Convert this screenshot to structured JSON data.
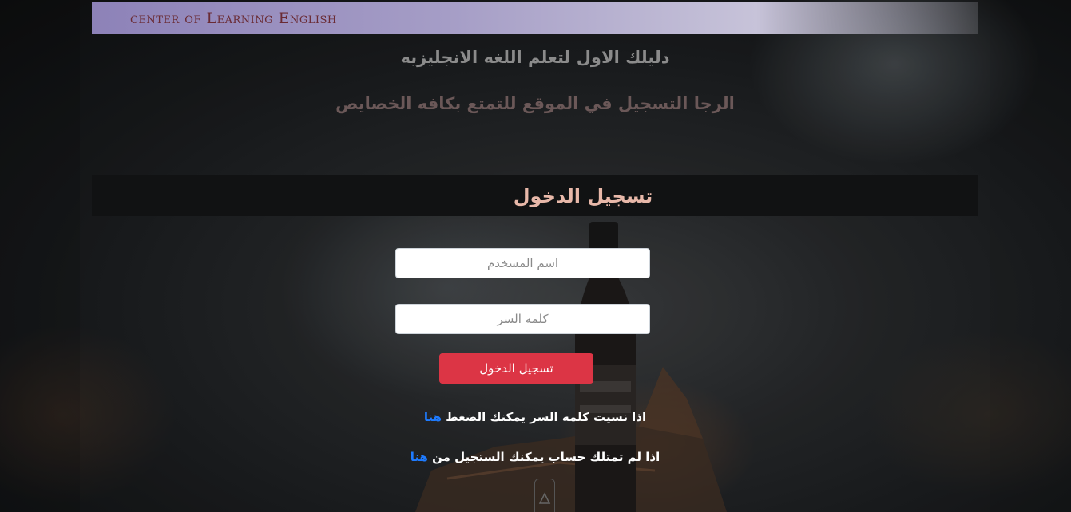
{
  "header": {
    "brand": "center of Learning English"
  },
  "hero": {
    "title": "دليلك الاول لتعلم اللغه الانجليزيه",
    "subtitle": "الرجا التسجيل في الموقع للتمتع بكافه الخصايص"
  },
  "login": {
    "heading": "تسجيل الدخول",
    "username_placeholder": "اسم المسخدم",
    "password_placeholder": "كلمه السر",
    "submit_label": "تسجيل الدخول",
    "forgot_text": "اذا نسيت كلمه السر يمكنك الضغط",
    "forgot_link": "هنا",
    "signup_text": "اذا لم تمتلك حساب يمكنك الستجيل من",
    "signup_link": "هنا"
  },
  "colors": {
    "accent": "#dc3545",
    "link": "#1e7bff",
    "brand": "#6a2b34"
  },
  "icons": {
    "bottom": "scroll-up-icon"
  }
}
